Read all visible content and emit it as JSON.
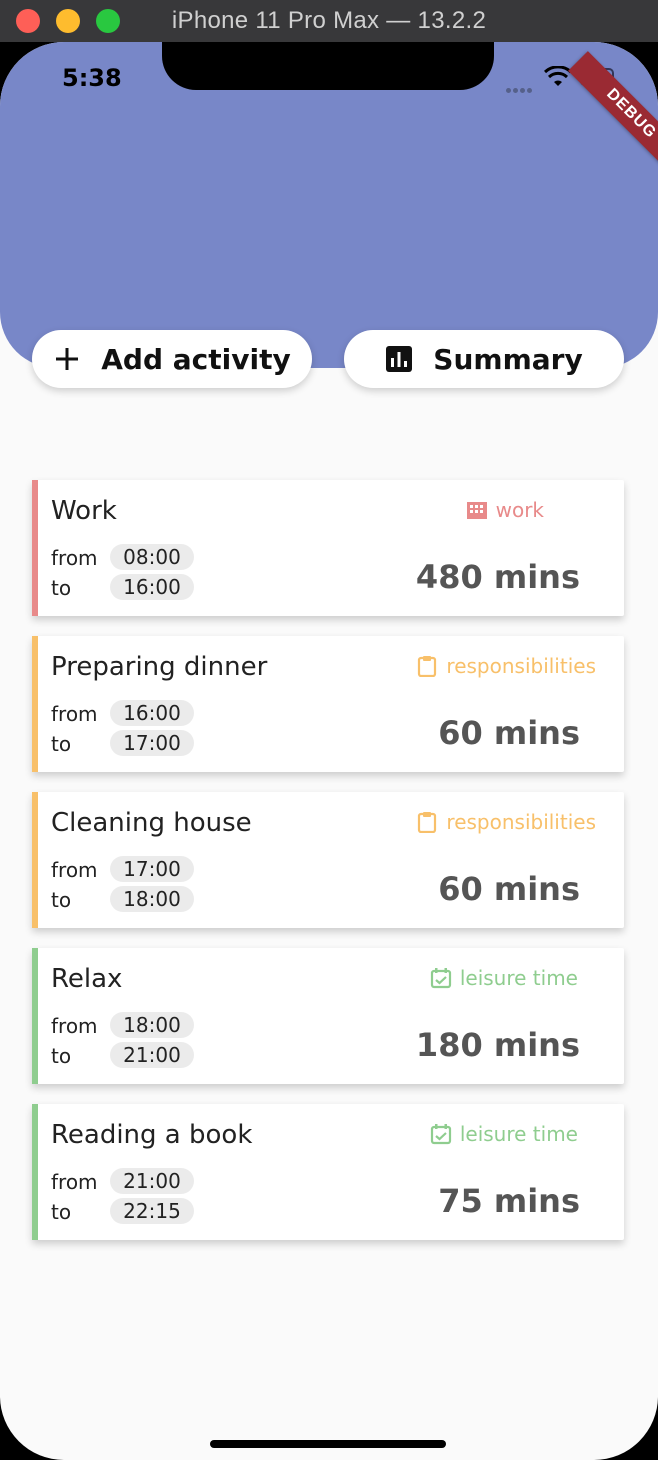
{
  "window": {
    "title": "iPhone 11 Pro Max — 13.2.2"
  },
  "status_bar": {
    "time": "5:38"
  },
  "debug_banner": "DEBUG",
  "buttons": {
    "add_label": "Add activity",
    "summary_label": "Summary"
  },
  "colors": {
    "header": "#7887c8",
    "work": "#e88a8a",
    "responsibilities": "#f8c06a",
    "leisure": "#8fcd8f"
  },
  "activities": [
    {
      "title": "Work",
      "from_label": "from",
      "to_label": "to",
      "from": "08:00",
      "to": "16:00",
      "category": "work",
      "category_icon": "building-icon",
      "duration": "480 mins"
    },
    {
      "title": "Preparing dinner",
      "from_label": "from",
      "to_label": "to",
      "from": "16:00",
      "to": "17:00",
      "category": "responsibilities",
      "category_icon": "clipboard-icon",
      "duration": "60 mins"
    },
    {
      "title": "Cleaning house",
      "from_label": "from",
      "to_label": "to",
      "from": "17:00",
      "to": "18:00",
      "category": "responsibilities",
      "category_icon": "clipboard-icon",
      "duration": "60 mins"
    },
    {
      "title": "Relax",
      "from_label": "from",
      "to_label": "to",
      "from": "18:00",
      "to": "21:00",
      "category": "leisure time",
      "category_icon": "calendar-check-icon",
      "duration": "180 mins"
    },
    {
      "title": "Reading a book",
      "from_label": "from",
      "to_label": "to",
      "from": "21:00",
      "to": "22:15",
      "category": "leisure time",
      "category_icon": "calendar-check-icon",
      "duration": "75 mins"
    }
  ]
}
